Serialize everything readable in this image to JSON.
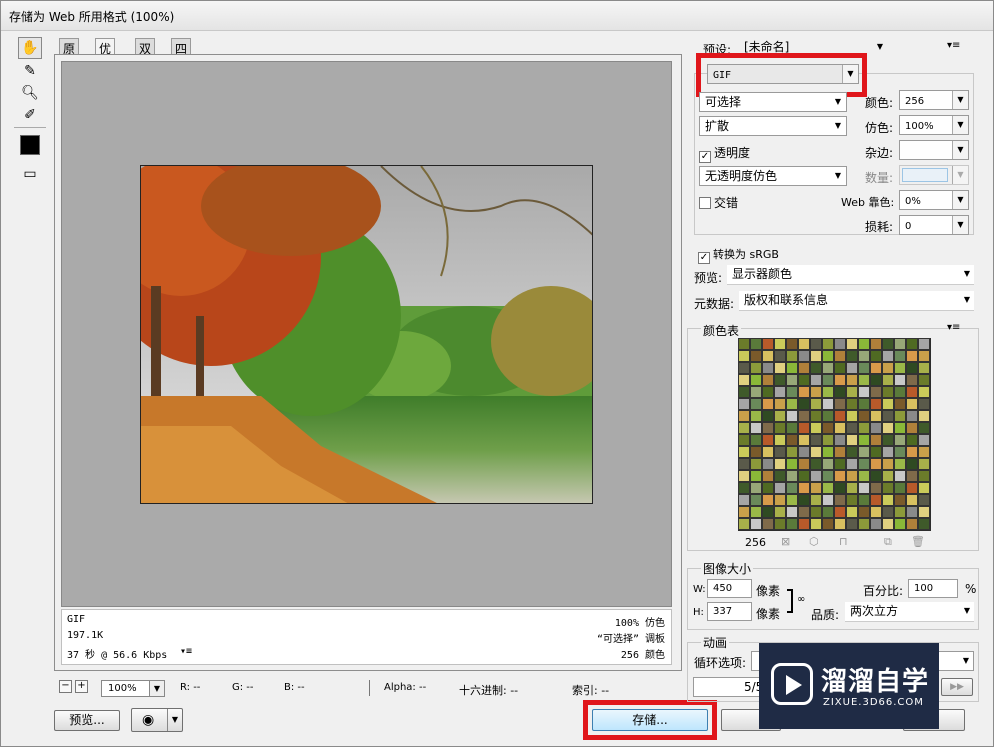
{
  "window": {
    "title": "存储为 Web 所用格式 (100%)"
  },
  "tabs": [
    "原稿",
    "优化",
    "双联",
    "四联"
  ],
  "info": {
    "left": [
      "GIF",
      "197.1K",
      "37 秒 @ 56.6 Kbps"
    ],
    "right": [
      "100% 仿色",
      "“可选择” 调板",
      "256 颜色"
    ]
  },
  "bottom": {
    "zoom": "100%",
    "r": "R: --",
    "g": "G: --",
    "b": "B: --",
    "alpha": "Alpha: --",
    "hex": "十六进制: --",
    "index": "索引: --"
  },
  "buttons": {
    "preview": "预览...",
    "save": "存储..."
  },
  "settings": {
    "preset_label": "预设:",
    "preset_value": "[未命名]",
    "format": "GIF",
    "reduction": "可选择",
    "colors_label": "颜色:",
    "colors": "256",
    "dither_algo": "扩散",
    "dither_label": "仿色:",
    "dither": "100%",
    "transparency": "透明度",
    "matte_label": "杂边:",
    "trans_dither": "无透明度仿色",
    "amount_label": "数量:",
    "interlaced": "交错",
    "websnap_label": "Web 靠色:",
    "websnap": "0%",
    "lossy_label": "损耗:",
    "lossy": "0",
    "convert_srgb": "转换为 sRGB",
    "preview_label": "预览:",
    "preview_value": "显示器颜色",
    "metadata_label": "元数据:",
    "metadata_value": "版权和联系信息"
  },
  "color_table": {
    "title": "颜色表",
    "count": "256"
  },
  "image_size": {
    "title": "图像大小",
    "w_label": "W:",
    "w": "450",
    "h_label": "H:",
    "h": "337",
    "unit": "像素",
    "percent_label": "百分比:",
    "percent": "100",
    "percent_unit": "%",
    "quality_label": "品质:",
    "quality": "两次立方"
  },
  "animation": {
    "title": "动画",
    "loop_label": "循环选项:",
    "frame": "5/5"
  },
  "watermark": {
    "brand": "溜溜自学",
    "url": "ZIXUE.3D66.COM"
  }
}
